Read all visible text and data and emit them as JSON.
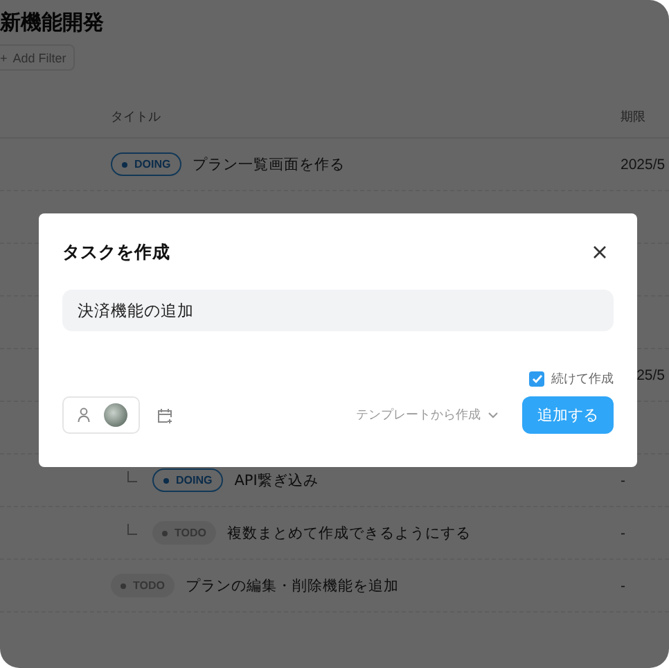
{
  "project": {
    "title": "新機能開発",
    "add_filter_icon": "+",
    "add_filter": "Add Filter"
  },
  "columns": [
    "タイトル",
    "期限"
  ],
  "rows": [
    {
      "kind": "task",
      "badge": {
        "kind": "doing",
        "label": "DOING"
      },
      "title": "プラン一覧画面を作る",
      "due": "2025/5"
    },
    {
      "kind": "covered"
    },
    {
      "kind": "covered"
    },
    {
      "kind": "covered"
    },
    {
      "kind": "date_only",
      "due": "25/5"
    },
    {
      "kind": "covered",
      "children": [
        {
          "kind": "task",
          "badge": {
            "kind": "doing",
            "label": "DOING"
          },
          "title": "API繋ぎ込み",
          "due": "-"
        },
        {
          "kind": "task",
          "badge": {
            "kind": "todo",
            "label": "TODO"
          },
          "title": "複数まとめて作成できるようにする",
          "due": "-"
        }
      ]
    },
    {
      "kind": "task",
      "badge": {
        "kind": "todo",
        "label": "TODO"
      },
      "title": "プランの編集・削除機能を追加",
      "due": "-"
    }
  ],
  "modal": {
    "title": "タスクを作成",
    "task_name": "決済機能の追加",
    "continue_creating": {
      "label": "続けて作成",
      "checked": true
    },
    "template": "テンプレートから作成",
    "submit": "追加する"
  }
}
